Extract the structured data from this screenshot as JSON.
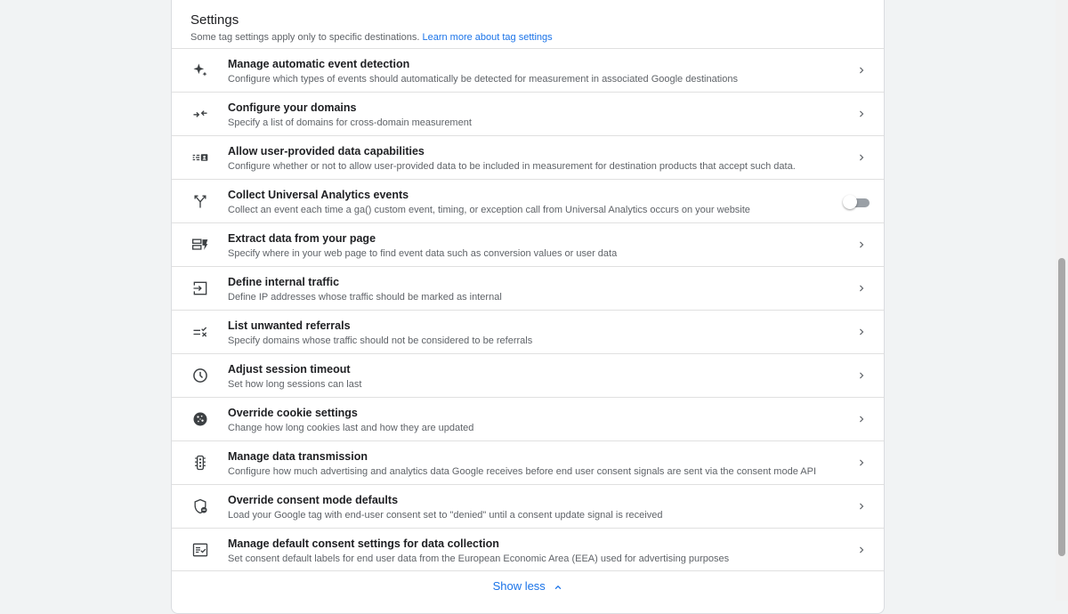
{
  "settings": {
    "title": "Settings",
    "subtitle": "Some tag settings apply only to specific destinations.",
    "learn_more": "Learn more about tag settings",
    "items": [
      {
        "title": "Manage automatic event detection",
        "desc": "Configure which types of events should automatically be detected for measurement in associated Google destinations",
        "icon": "sparkle-icon"
      },
      {
        "title": "Configure your domains",
        "desc": "Specify a list of domains for cross-domain measurement",
        "icon": "domains-arrows-icon"
      },
      {
        "title": "Allow user-provided data capabilities",
        "desc": "Configure whether or not to allow user-provided data to be included in measurement for destination products that accept such data.",
        "icon": "user-data-icon"
      },
      {
        "title": "Collect Universal Analytics events",
        "desc": "Collect an event each time a ga() custom event, timing, or exception call from Universal Analytics occurs on your website",
        "icon": "fork-arrows-icon",
        "toggle": "off"
      },
      {
        "title": "Extract data from your page",
        "desc": "Specify where in your web page to find event data such as conversion values or user data",
        "icon": "extract-data-icon"
      },
      {
        "title": "Define internal traffic",
        "desc": "Define IP addresses whose traffic should be marked as internal",
        "icon": "login-box-icon"
      },
      {
        "title": "List unwanted referrals",
        "desc": "Specify domains whose traffic should not be considered to be referrals",
        "icon": "referral-list-icon"
      },
      {
        "title": "Adjust session timeout",
        "desc": "Set how long sessions can last",
        "icon": "clock-icon"
      },
      {
        "title": "Override cookie settings",
        "desc": "Change how long cookies last and how they are updated",
        "icon": "cookie-icon"
      },
      {
        "title": "Manage data transmission",
        "desc": "Configure how much advertising and analytics data Google receives before end user consent signals are sent via the consent mode API",
        "icon": "traffic-light-icon"
      },
      {
        "title": "Override consent mode defaults",
        "desc": "Load your Google tag with end-user consent set to \"denied\" until a consent update signal is received",
        "icon": "shield-minus-icon"
      },
      {
        "title": "Manage default consent settings for data collection",
        "desc": "Set consent default labels for end user data from the European Economic Area (EEA) used for advertising purposes",
        "icon": "checklist-icon"
      }
    ],
    "show_less": "Show less"
  },
  "colors": {
    "accent": "#1a73e8",
    "text": "#202124",
    "secondary": "#5f6368",
    "background": "#f1f3f4"
  }
}
